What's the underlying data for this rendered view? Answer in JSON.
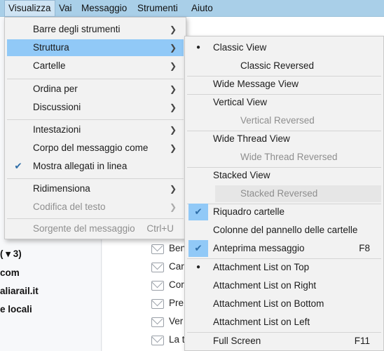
{
  "menubar": {
    "items": [
      {
        "label": "Visualizza",
        "u": "V"
      },
      {
        "label": "Vai"
      },
      {
        "label": "Messaggio"
      },
      {
        "label": "Strumenti"
      },
      {
        "label": "Aiuto"
      }
    ]
  },
  "background": {
    "folders": [
      "( ▾ 3)",
      "com",
      "aliarail.it",
      "e locali"
    ],
    "messages": [
      "Ben",
      "Car",
      "Cor",
      "Pre",
      "Ver",
      "La t"
    ]
  },
  "visualizza_menu": {
    "barre": "Barre degli strumenti",
    "struttura": "Struttura",
    "cartelle": "Cartelle",
    "ordina": "Ordina per",
    "discussioni": "Discussioni",
    "intestazioni": "Intestazioni",
    "corpo": "Corpo del messaggio come",
    "mostra_allegati": "Mostra allegati in linea",
    "ridimensiona": "Ridimensiona",
    "codifica": "Codifica del testo",
    "sorgente": "Sorgente del messaggio",
    "sorgente_shortcut": "Ctrl+U"
  },
  "struttura_menu": {
    "classic_view": "Classic View",
    "classic_reversed": "Classic Reversed",
    "wide_message_view": "Wide Message View",
    "vertical_view": "Vertical View",
    "vertical_reversed": "Vertical Reversed",
    "wide_thread_view": "Wide Thread View",
    "wide_thread_reversed": "Wide Thread Reversed",
    "stacked_view": "Stacked View",
    "stacked_reversed": "Stacked Reversed",
    "riquadro_cartelle": "Riquadro cartelle",
    "colonne_pannello": "Colonne del pannello delle cartelle",
    "anteprima": "Anteprima messaggio",
    "anteprima_shortcut": "F8",
    "att_top": "Attachment List on Top",
    "att_right": "Attachment List on Right",
    "att_bottom": "Attachment List on Bottom",
    "att_left": "Attachment List on Left",
    "full_screen": "Full Screen",
    "full_screen_shortcut": "F11"
  },
  "colors": {
    "menubar_bg": "#a9cfe8",
    "highlight": "#91c9f7",
    "disabled_text": "#8e8e8e",
    "check_color": "#2f6ea8"
  }
}
